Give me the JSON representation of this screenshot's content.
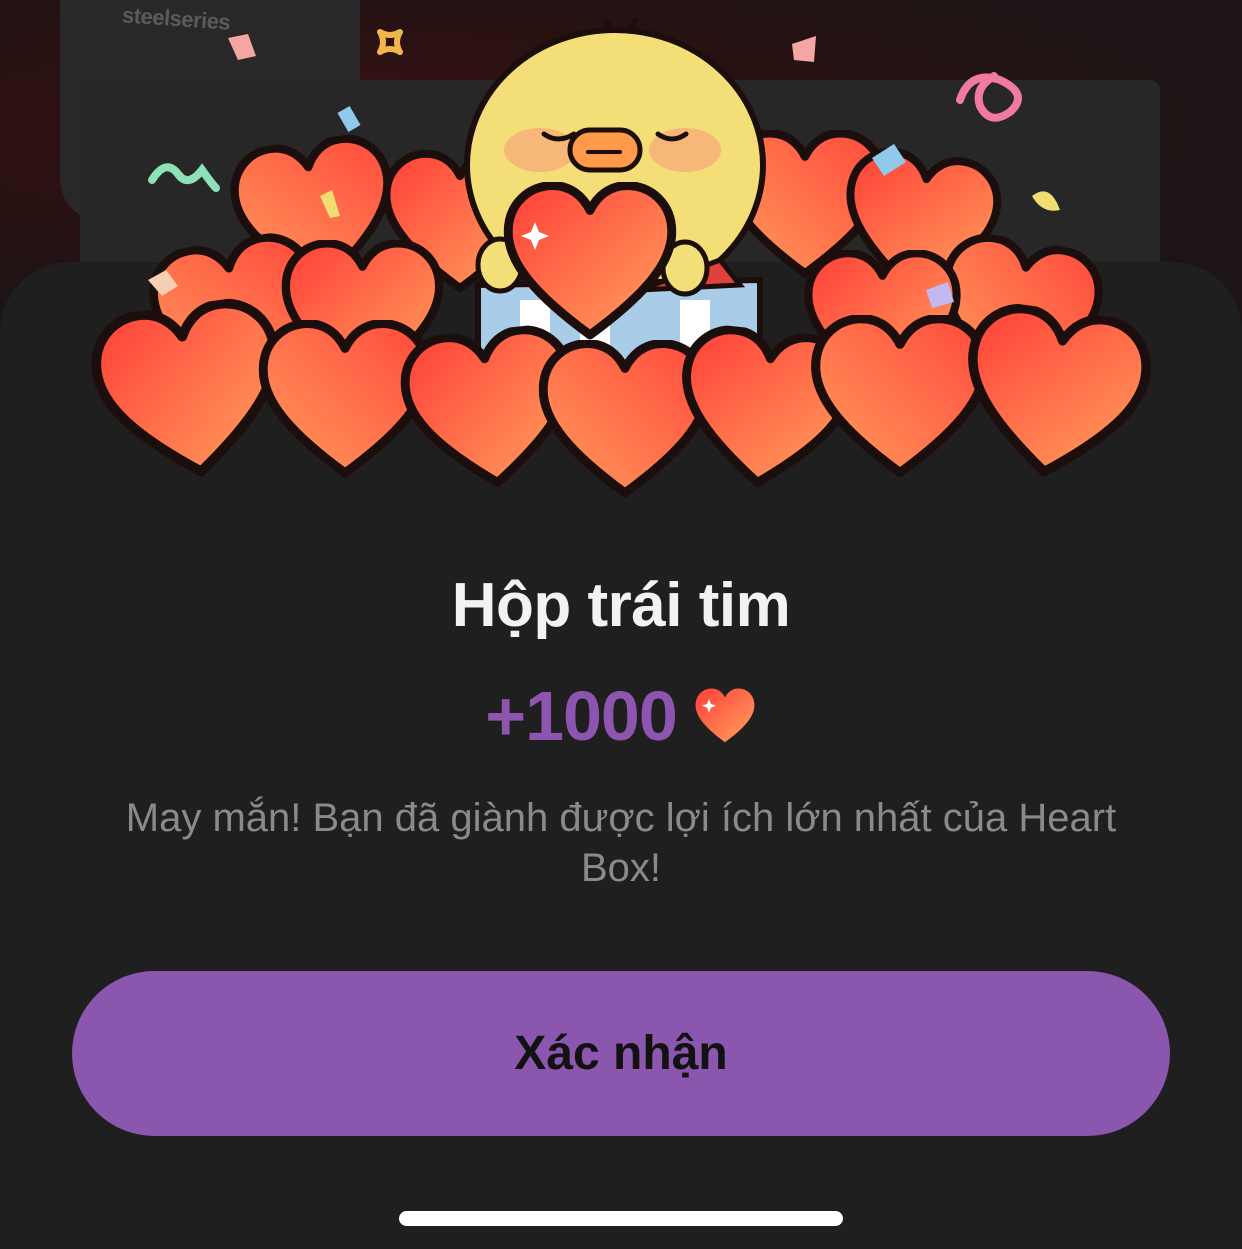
{
  "background": {
    "watermark": "steelseries"
  },
  "dialog": {
    "title": "Hộp trái tim",
    "reward_amount": "+1000",
    "reward_icon": "heart-icon",
    "message": "May mắn! Bạn đã giành được lợi ích lớn nhất của Heart Box!",
    "confirm_label": "Xác nhận"
  },
  "colors": {
    "accent": "#8a56ae",
    "reward_text": "#8d55b0",
    "sheet_background": "#1f1f1f",
    "title_text": "#f2f2f2",
    "message_text": "#8a8a8a",
    "heart_light": "#ff9a5c",
    "heart_dark": "#ff4a3c"
  }
}
